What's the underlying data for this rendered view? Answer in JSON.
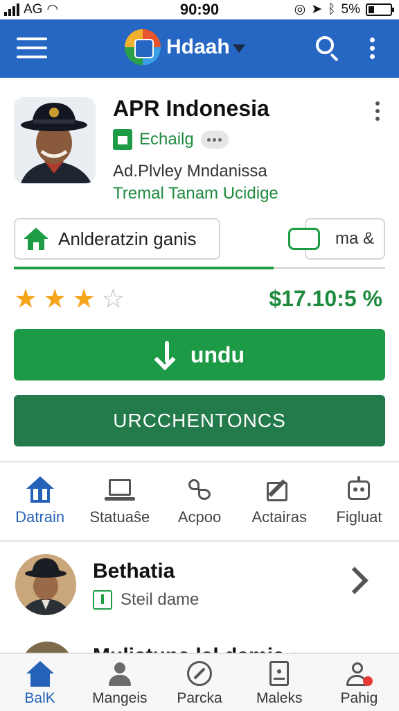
{
  "status_bar": {
    "carrier": "AG",
    "time": "90:90",
    "battery": "5%"
  },
  "app_bar": {
    "brand": "Hdaah"
  },
  "app": {
    "title": "APR Indonesia",
    "developer": "Echailg",
    "subtitle": "Ad.Plvley Mndanissa",
    "tagline": "Tremal Tanam Ucidige",
    "chip_left": "Anlderatzin ganis",
    "chip_right": "ma &",
    "progress": 0.7,
    "rating": 3,
    "rating_max": 4,
    "price": "$17.10:5 %",
    "download_label": "undu",
    "secondary_label": "URCCHENTONCS"
  },
  "tabs": [
    {
      "label": "Datrain",
      "icon": "home-upload-icon",
      "active": true
    },
    {
      "label": "Statuaŝe",
      "icon": "laptop-icon",
      "active": false
    },
    {
      "label": "Acpoo",
      "icon": "puzzle-icon",
      "active": false
    },
    {
      "label": "Actairas",
      "icon": "edit-icon",
      "active": false
    },
    {
      "label": "Figluat",
      "icon": "robot-icon",
      "active": false
    }
  ],
  "list": [
    {
      "title": "Bethatia",
      "subtitle": "Steil dame"
    },
    {
      "title": "Mulistuna lal damia",
      "meta": "+ - - - ~"
    }
  ],
  "bottom_nav": [
    {
      "label": "BalK",
      "icon": "home-icon",
      "active": true
    },
    {
      "label": "Mangeis",
      "icon": "person-icon",
      "active": false
    },
    {
      "label": "Parcka",
      "icon": "compass-icon",
      "active": false
    },
    {
      "label": "Maleks",
      "icon": "document-icon",
      "active": false
    },
    {
      "label": "Pahig",
      "icon": "profile-alert-icon",
      "active": false
    }
  ],
  "colors": {
    "primary_blue": "#2667c4",
    "accent_green": "#1c9a45",
    "secondary_green": "#237a4a",
    "star": "#f4a51c"
  }
}
